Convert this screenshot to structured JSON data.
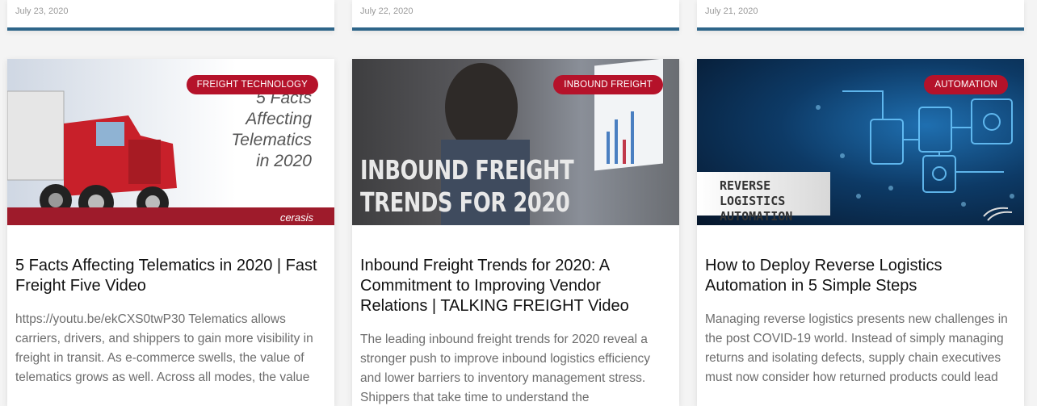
{
  "top_cards": [
    {
      "date": "July 23, 2020"
    },
    {
      "date": "July 22, 2020"
    },
    {
      "date": "July 21, 2020"
    }
  ],
  "posts": [
    {
      "category": "FREIGHT TECHNOLOGY",
      "image": {
        "overlay_lines": [
          "5 Facts",
          "Affecting",
          "Telematics",
          "in 2020"
        ],
        "logo": "cerasis"
      },
      "title": "5 Facts Affecting Telematics in 2020 | Fast Freight Five Video",
      "excerpt": "https://youtu.be/ekCXS0twP30 Telematics allows carriers, drivers, and shippers to gain more visibility in freight in transit. As e-commerce swells, the value of telematics grows as well. Across all modes, the value"
    },
    {
      "category": "INBOUND FREIGHT",
      "image": {
        "overlay_lines": [
          "INBOUND FREIGHT",
          "TRENDS FOR 2020"
        ]
      },
      "title": "Inbound Freight Trends for 2020: A Commitment to Improving Vendor Relations | TALKING FREIGHT Video",
      "excerpt": "The leading inbound freight trends for 2020 reveal a stronger push to improve inbound logistics efficiency and lower barriers to inventory management stress. Shippers that take time to understand the"
    },
    {
      "category": "AUTOMATION",
      "image": {
        "overlay_lines": [
          "REVERSE LOGISTICS",
          "AUTOMATION"
        ]
      },
      "title": "How to Deploy Reverse Logistics Automation in 5 Simple Steps",
      "excerpt": "Managing reverse logistics presents new challenges in the post COVID-19 world. Instead of simply managing returns and isolating defects, supply chain executives must now consider how returned products could lead"
    }
  ],
  "colors": {
    "badge": "#b5122a",
    "accent_border": "#2e6589",
    "title_text": "#111111",
    "excerpt_text": "#6d6d6d"
  }
}
